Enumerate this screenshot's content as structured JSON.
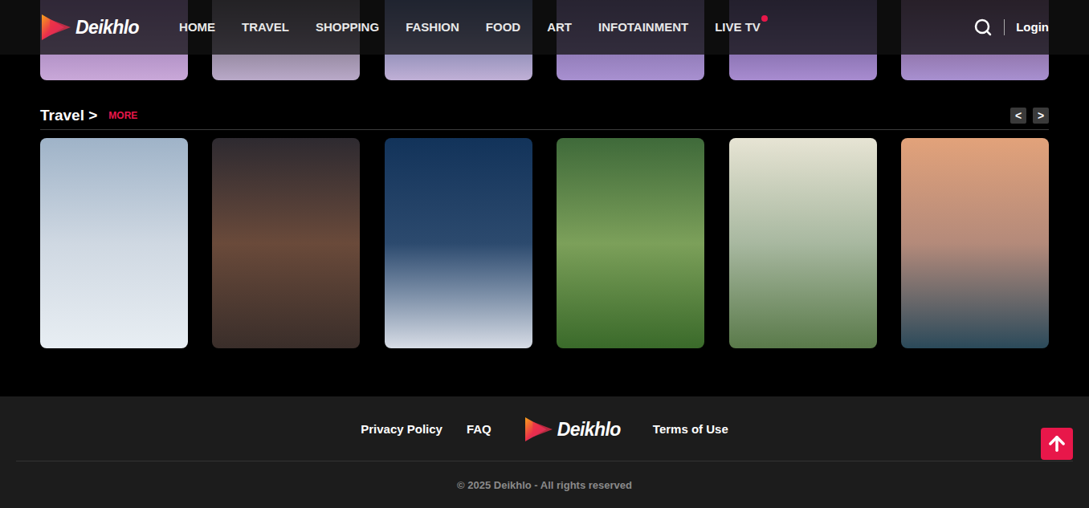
{
  "header": {
    "logo": "Deikhlo",
    "nav": [
      {
        "label": "HOME",
        "selected": false,
        "live": false
      },
      {
        "label": "TRAVEL",
        "selected": false,
        "live": false
      },
      {
        "label": "SHOPPING",
        "selected": false,
        "live": false
      },
      {
        "label": "FASHION",
        "selected": false,
        "live": false
      },
      {
        "label": "FOOD",
        "selected": false,
        "live": false
      },
      {
        "label": "ART",
        "selected": false,
        "live": false
      },
      {
        "label": "INFOTAINMENT",
        "selected": false,
        "live": false
      },
      {
        "label": "LIVE TV",
        "selected": false,
        "live": true
      }
    ],
    "login": "Login"
  },
  "top_row": {
    "cards": 6
  },
  "section": {
    "title": "Travel >",
    "more": "MORE",
    "prev": "<",
    "next": ">",
    "cards": 6
  },
  "footer": {
    "links_left": [
      "Privacy Policy",
      "FAQ"
    ],
    "logo": "Deikhlo",
    "links_right": [
      "Terms of Use"
    ],
    "copyright": "© 2025 Deikhlo - All rights reserved"
  }
}
